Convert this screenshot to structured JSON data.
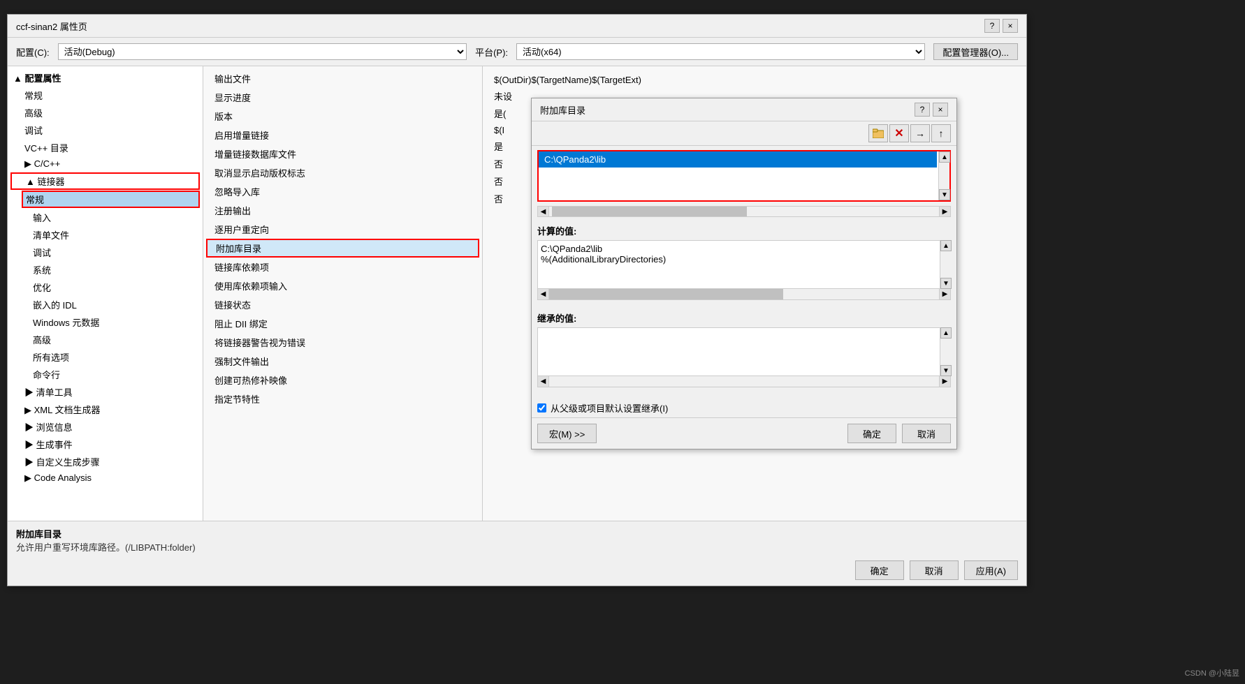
{
  "editor": {
    "bg_color": "#1e1e1e"
  },
  "properties_dialog": {
    "title": "ccf-sinan2 属性页",
    "help_btn": "?",
    "close_btn": "×",
    "config_label": "配置(C):",
    "config_value": "活动(Debug)",
    "platform_label": "平台(P):",
    "platform_value": "活动(x64)",
    "config_manager_btn": "配置管理器(O)..."
  },
  "sidebar": {
    "items": [
      {
        "label": "▲ 配置属性",
        "level": 0,
        "expanded": true,
        "selected": false
      },
      {
        "label": "常规",
        "level": 1,
        "expanded": false,
        "selected": false
      },
      {
        "label": "高级",
        "level": 1,
        "expanded": false,
        "selected": false
      },
      {
        "label": "调试",
        "level": 1,
        "expanded": false,
        "selected": false
      },
      {
        "label": "VC++ 目录",
        "level": 1,
        "expanded": false,
        "selected": false
      },
      {
        "label": "▶ C/C++",
        "level": 1,
        "expanded": false,
        "selected": false
      },
      {
        "label": "▲ 链接器",
        "level": 1,
        "expanded": true,
        "selected": false,
        "red_border": true
      },
      {
        "label": "常规",
        "level": 2,
        "expanded": false,
        "selected": true,
        "red_border": true
      },
      {
        "label": "输入",
        "level": 2,
        "expanded": false,
        "selected": false
      },
      {
        "label": "清单文件",
        "level": 2,
        "expanded": false,
        "selected": false
      },
      {
        "label": "调试",
        "level": 2,
        "expanded": false,
        "selected": false
      },
      {
        "label": "系统",
        "level": 2,
        "expanded": false,
        "selected": false
      },
      {
        "label": "优化",
        "level": 2,
        "expanded": false,
        "selected": false
      },
      {
        "label": "嵌入的 IDL",
        "level": 2,
        "expanded": false,
        "selected": false
      },
      {
        "label": "Windows 元数据",
        "level": 2,
        "expanded": false,
        "selected": false
      },
      {
        "label": "高级",
        "level": 2,
        "expanded": false,
        "selected": false
      },
      {
        "label": "所有选项",
        "level": 2,
        "expanded": false,
        "selected": false
      },
      {
        "label": "命令行",
        "level": 2,
        "expanded": false,
        "selected": false
      },
      {
        "label": "▶ 清单工具",
        "level": 1,
        "expanded": false,
        "selected": false
      },
      {
        "label": "▶ XML 文档生成器",
        "level": 1,
        "expanded": false,
        "selected": false
      },
      {
        "label": "▶ 浏览信息",
        "level": 1,
        "expanded": false,
        "selected": false
      },
      {
        "label": "▶ 生成事件",
        "level": 1,
        "expanded": false,
        "selected": false
      },
      {
        "label": "▶ 自定义生成步骤",
        "level": 1,
        "expanded": false,
        "selected": false
      },
      {
        "label": "▶ Code Analysis",
        "level": 1,
        "expanded": false,
        "selected": false
      }
    ]
  },
  "middle_panel": {
    "items": [
      {
        "label": "输出文件",
        "selected": false,
        "red_border": false
      },
      {
        "label": "显示进度",
        "selected": false,
        "red_border": false
      },
      {
        "label": "版本",
        "selected": false,
        "red_border": false
      },
      {
        "label": "启用增量链接",
        "selected": false,
        "red_border": false
      },
      {
        "label": "增量链接数据库文件",
        "selected": false,
        "red_border": false
      },
      {
        "label": "取消显示启动版权标志",
        "selected": false,
        "red_border": false
      },
      {
        "label": "忽略导入库",
        "selected": false,
        "red_border": false
      },
      {
        "label": "注册输出",
        "selected": false,
        "red_border": false
      },
      {
        "label": "逐用户重定向",
        "selected": false,
        "red_border": false
      },
      {
        "label": "附加库目录",
        "selected": true,
        "red_border": true
      },
      {
        "label": "链接库依赖项",
        "selected": false,
        "red_border": false
      },
      {
        "label": "使用库依赖项输入",
        "selected": false,
        "red_border": false
      },
      {
        "label": "链接状态",
        "selected": false,
        "red_border": false
      },
      {
        "label": "阻止 DII 绑定",
        "selected": false,
        "red_border": false
      },
      {
        "label": "将链接器警告视为错误",
        "selected": false,
        "red_border": false
      },
      {
        "label": "强制文件输出",
        "selected": false,
        "red_border": false
      },
      {
        "label": "创建可热修补映像",
        "selected": false,
        "red_border": false
      },
      {
        "label": "指定节特性",
        "selected": false,
        "red_border": false
      }
    ]
  },
  "right_panel": {
    "rows": [
      {
        "label": "$(OutDir)$(TargetName)$(TargetExt)",
        "value": ""
      },
      {
        "label": "未设",
        "value": ""
      },
      {
        "label": "是(",
        "value": ""
      },
      {
        "label": "$(I",
        "value": ""
      },
      {
        "label": "是",
        "value": ""
      },
      {
        "label": "否",
        "value": ""
      },
      {
        "label": "否",
        "value": ""
      },
      {
        "label": "否",
        "value": ""
      }
    ]
  },
  "bottom": {
    "section_title": "附加库目录",
    "description": "允许用户重写环境库路径。(/LIBPATH:folder)",
    "confirm_btn": "确定",
    "cancel_btn": "取消",
    "apply_btn": "应用(A)"
  },
  "sub_dialog": {
    "title": "附加库目录",
    "help_btn": "?",
    "close_btn": "×",
    "toolbar_folder_btn": "📁",
    "toolbar_delete_btn": "✕",
    "toolbar_arrow_btn": "→",
    "toolbar_up_btn": "↑",
    "list_item": "C:\\QPanda2\\lib",
    "computed_label": "计算的值:",
    "computed_line1": "C:\\QPanda2\\lib",
    "computed_line2": "%(AdditionalLibraryDirectories)",
    "inherited_label": "继承的值:",
    "checkbox_label": "从父级或项目默认设置继承(I)",
    "macro_btn": "宏(M) >>",
    "confirm_btn": "确定",
    "cancel_btn": "取消"
  },
  "watermark": "CSDN @小陆昱"
}
